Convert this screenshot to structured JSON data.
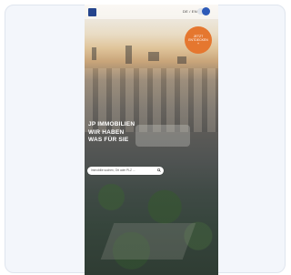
{
  "header": {
    "lang_label": "DE / EN"
  },
  "badge": {
    "lines": [
      "JETZT",
      "ENTDECKEN",
      "+"
    ]
  },
  "hero": {
    "headline_lines": [
      "JP IMMOBILIEN",
      "WIR HABEN",
      "WAS FÜR SIE"
    ]
  },
  "search": {
    "placeholder": "Immobilie suchen, Ort oder PLZ ..."
  },
  "colors": {
    "brand_blue": "#25458d",
    "accent_orange": "#e5772f",
    "card_bg": "#f3f6fb"
  },
  "icons": {
    "logo": "jp-logo",
    "search": "search-icon"
  }
}
